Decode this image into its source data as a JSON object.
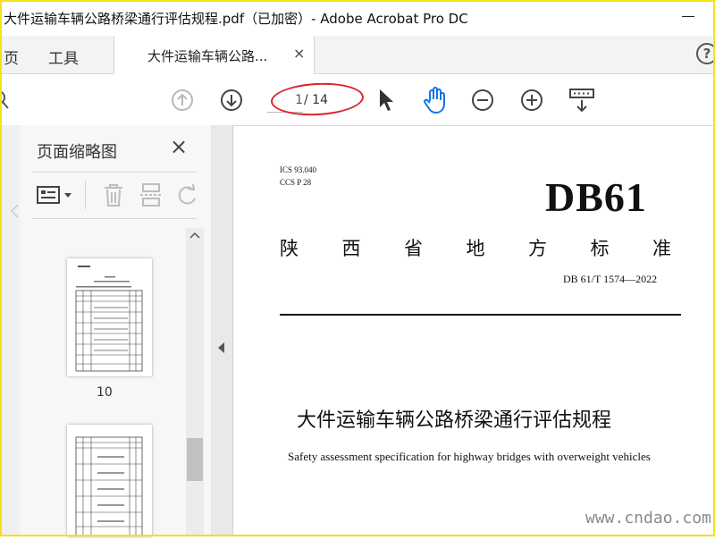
{
  "window": {
    "title": "大件运输车辆公路桥梁通行评估规程.pdf（已加密）- Adobe Acrobat Pro DC"
  },
  "menu": {
    "home": "页",
    "tools": "工具"
  },
  "tab": {
    "label": "大件运输车辆公路...",
    "close": "×"
  },
  "help": {
    "label": "?"
  },
  "toolbar": {
    "page_current": "1",
    "page_total": "/ 14"
  },
  "thumbnails": {
    "title": "页面缩略图",
    "close": "×",
    "visible_page_number": "10"
  },
  "document": {
    "ics": "ICS  93.040",
    "ccs": "CCS  P  28",
    "code": "DB61",
    "standard_type_chars": [
      "陕",
      "西",
      "省",
      "地",
      "方",
      "标",
      "准"
    ],
    "standard_number": "DB 61/T  1574—2022",
    "title_cn": "大件运输车辆公路桥梁通行评估规程",
    "title_en": "Safety assessment specification for highway bridges with overweight vehicles"
  },
  "watermark": {
    "text": "www.cndao.com"
  },
  "colors": {
    "frame": "#f2e21a",
    "highlight_ellipse": "#d8252b",
    "hand_tool": "#1473e6"
  }
}
